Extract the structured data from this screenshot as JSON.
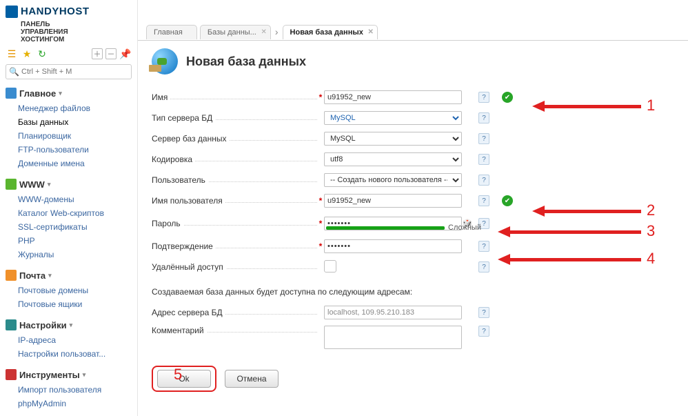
{
  "brand": {
    "name": "HANDYHOST",
    "subtitle": "ПАНЕЛЬ\nУПРАВЛЕНИЯ\nХОСТИНГОМ"
  },
  "search": {
    "placeholder": "Ctrl + Shift + M"
  },
  "nav": {
    "groups": [
      {
        "title": "Главное",
        "icon": "blue",
        "items": [
          {
            "label": "Менеджер файлов",
            "active": false
          },
          {
            "label": "Базы данных",
            "active": true
          },
          {
            "label": "Планировщик",
            "active": false
          },
          {
            "label": "FTP-пользователи",
            "active": false
          },
          {
            "label": "Доменные имена",
            "active": false
          }
        ]
      },
      {
        "title": "WWW",
        "icon": "green",
        "items": [
          {
            "label": "WWW-домены"
          },
          {
            "label": "Каталог Web-скриптов"
          },
          {
            "label": "SSL-сертификаты"
          },
          {
            "label": "PHP"
          },
          {
            "label": "Журналы"
          }
        ]
      },
      {
        "title": "Почта",
        "icon": "orange",
        "items": [
          {
            "label": "Почтовые домены"
          },
          {
            "label": "Почтовые ящики"
          }
        ]
      },
      {
        "title": "Настройки",
        "icon": "teal",
        "items": [
          {
            "label": "IP-адреса"
          },
          {
            "label": "Настройки пользоват..."
          }
        ]
      },
      {
        "title": "Инструменты",
        "icon": "red",
        "items": [
          {
            "label": "Импорт пользователя"
          },
          {
            "label": "phpMyAdmin"
          }
        ]
      }
    ]
  },
  "tabs": [
    {
      "label": "Главная",
      "closable": false
    },
    {
      "label": "Базы данны...",
      "closable": true
    },
    {
      "label": "Новая база данных",
      "closable": true,
      "active": true
    }
  ],
  "page": {
    "title": "Новая база данных"
  },
  "form": {
    "name": {
      "label": "Имя",
      "value": "u91952_new",
      "required": true,
      "ok": true
    },
    "dbtype": {
      "label": "Тип сервера БД",
      "value": "MySQL"
    },
    "dbserver": {
      "label": "Сервер баз данных",
      "value": "MySQL"
    },
    "encoding": {
      "label": "Кодировка",
      "value": "utf8"
    },
    "user": {
      "label": "Пользователь",
      "value": "-- Создать нового пользователя --"
    },
    "username": {
      "label": "Имя пользователя",
      "value": "u91952_new",
      "required": true,
      "ok": true
    },
    "password": {
      "label": "Пароль",
      "required": true,
      "strength": "Сложный"
    },
    "confirm": {
      "label": "Подтверждение",
      "required": true
    },
    "remote": {
      "label": "Удалённый доступ"
    },
    "note": "Создаваемая база данных будет доступна по следующим адресам:",
    "address": {
      "label": "Адрес сервера БД",
      "value": "localhost, 109.95.210.183"
    },
    "comment": {
      "label": "Комментарий"
    }
  },
  "buttons": {
    "ok": "Ok",
    "cancel": "Отмена"
  },
  "annotations": {
    "n1": "1",
    "n2": "2",
    "n3": "3",
    "n4": "4",
    "n5": "5"
  }
}
